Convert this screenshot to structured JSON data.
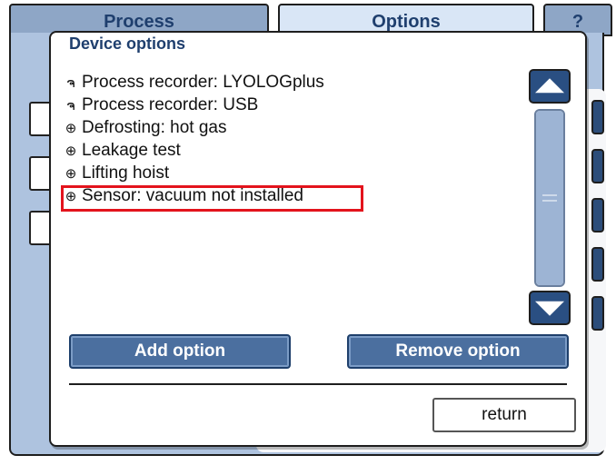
{
  "tabs": [
    {
      "label": "Process"
    },
    {
      "label": "Options"
    },
    {
      "label": "?"
    }
  ],
  "dialog": {
    "title": "Device options",
    "options": [
      {
        "icon": "lock-icon",
        "glyph": "ຈ",
        "label": "Process recorder: LYOLOGplus"
      },
      {
        "icon": "lock-icon",
        "glyph": "ຈ",
        "label": "Process recorder: USB"
      },
      {
        "icon": "circle-plus-icon",
        "glyph": "⊕",
        "label": "Defrosting: hot gas"
      },
      {
        "icon": "circle-plus-icon",
        "glyph": "⊕",
        "label": "Leakage test"
      },
      {
        "icon": "circle-plus-icon",
        "glyph": "⊕",
        "label": "Lifting hoist"
      },
      {
        "icon": "circle-plus-icon",
        "glyph": "⊕",
        "label": "Sensor: vacuum not installed",
        "highlighted": true
      }
    ],
    "buttons": {
      "add": "Add option",
      "remove": "Remove option",
      "return": "return"
    }
  },
  "colors": {
    "accent": "#2a4f82",
    "button": "#4b6f9f",
    "highlight": "#e3131c",
    "tab_active": "#d9e6f6",
    "tab_inactive": "#8ea6c6"
  }
}
